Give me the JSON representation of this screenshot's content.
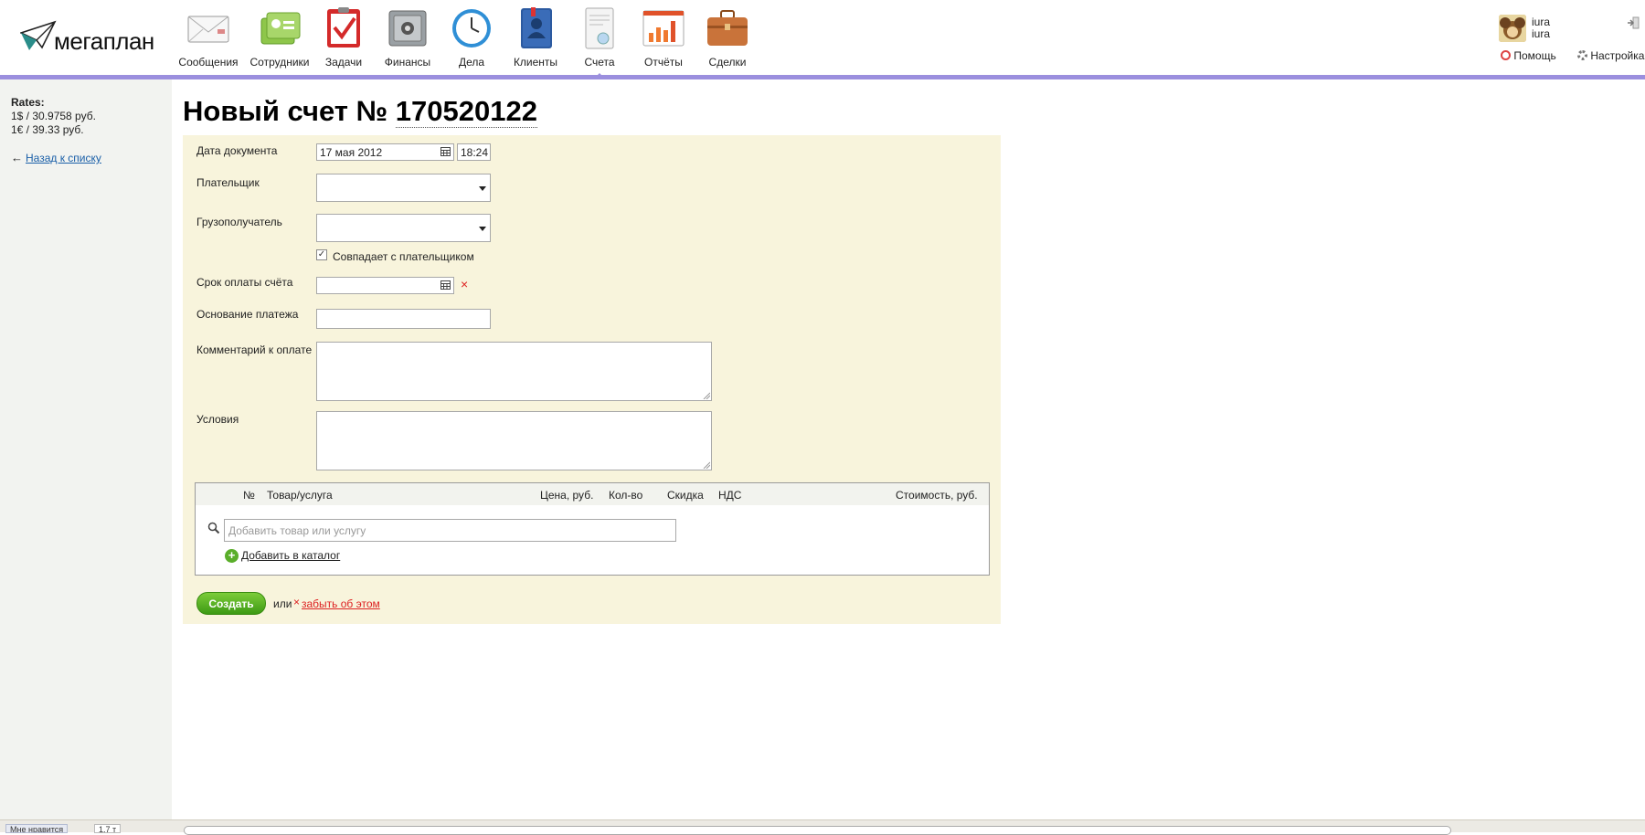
{
  "app": {
    "logo_text": "мегаплан"
  },
  "nav": [
    {
      "label": "Сообщения",
      "icon": "envelope-icon"
    },
    {
      "label": "Сотрудники",
      "icon": "employees-icon"
    },
    {
      "label": "Задачи",
      "icon": "tasks-checklist-icon"
    },
    {
      "label": "Финансы",
      "icon": "safe-icon"
    },
    {
      "label": "Дела",
      "icon": "clock-icon"
    },
    {
      "label": "Клиенты",
      "icon": "address-book-icon"
    },
    {
      "label": "Счета",
      "icon": "invoice-icon",
      "active": true
    },
    {
      "label": "Отчёты",
      "icon": "bar-chart-icon"
    },
    {
      "label": "Сделки",
      "icon": "briefcase-icon"
    }
  ],
  "user": {
    "line1": "iura",
    "line2": "iura",
    "help_label": "Помощь",
    "settings_label": "Настройка"
  },
  "sidebar": {
    "rates_title": "Rates:",
    "rate_usd": "1$ / 30.9758 руб.",
    "rate_eur": "1€ / 39.33 руб.",
    "back_arrow": "←",
    "back_link": "Назад к списку"
  },
  "page": {
    "title_prefix": "Новый счет №",
    "title_number": "170520122"
  },
  "form": {
    "date_label": "Дата документа",
    "date_value": "17 мая 2012",
    "time_value": "18:24",
    "payer_label": "Плательщик",
    "consignee_label": "Грузополучатель",
    "same_as_payer_label": "Совпадает с плательщиком",
    "same_as_payer_checked": true,
    "checkmark": "✓",
    "due_label": "Срок оплаты счёта",
    "clear_x": "×",
    "basis_label": "Основание платежа",
    "comment_label": "Комментарий к оплате",
    "terms_label": "Условия"
  },
  "items": {
    "columns": {
      "num": "№",
      "product": "Товар/услуга",
      "price": "Цена, руб.",
      "qty": "Кол-во",
      "discount": "Скидка",
      "vat": "НДС",
      "cost": "Стоимость, руб."
    },
    "add_placeholder": "Добавить товар или услугу",
    "plus": "+",
    "add_to_catalog": "Добавить в каталог"
  },
  "actions": {
    "create_label": "Создать",
    "or_text": "или",
    "forget_x": "×",
    "forget_label": "забыть об этом"
  },
  "bottom": {
    "like_label": "Мне нравится",
    "like_count": "1,7 т"
  },
  "colors": {
    "accent_bar": "#9b8fde",
    "form_bg": "#f8f4dc",
    "sidebar_bg": "#f2f3f0",
    "create_green": "#5aae2a",
    "link_blue": "#1a5fa8",
    "forget_red": "#dd2222"
  }
}
